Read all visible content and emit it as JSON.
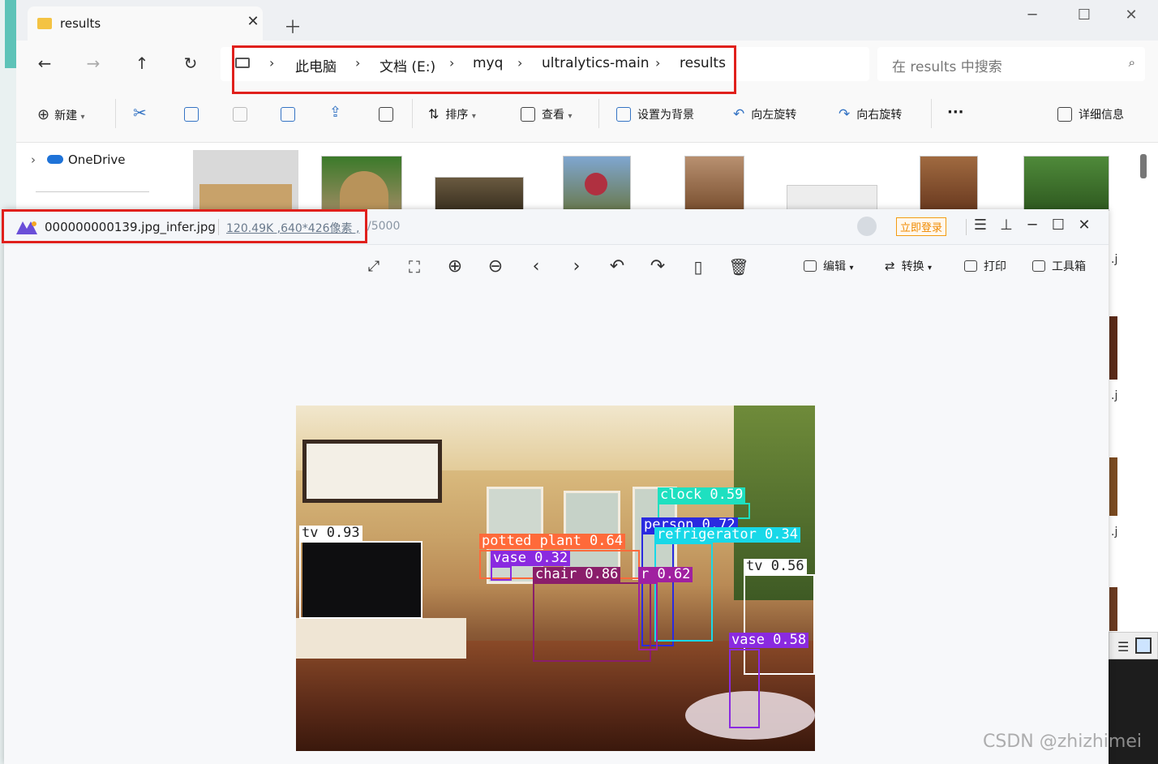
{
  "explorer": {
    "tab_title": "results",
    "address": {
      "crumbs": [
        "此电脑",
        "文档 (E:)",
        "myq",
        "ultralytics-main",
        "results"
      ]
    },
    "search_placeholder": "在 results 中搜索",
    "toolbar": {
      "new": "新建",
      "sort": "排序",
      "view": "查看",
      "set_background": "设置为背景",
      "rotate_left": "向左旋转",
      "rotate_right": "向右旋转",
      "more": "···",
      "details": "详细信息"
    },
    "sidebar": {
      "onedrive": "OneDrive"
    }
  },
  "viewer": {
    "filename": "000000000139.jpg_infer.jpg",
    "meta": "120.49K ,640*426像素 ,",
    "page": "/5000",
    "login": "立即登录",
    "tools": {
      "edit": "编辑",
      "convert": "转换",
      "print": "打印",
      "toolbox": "工具箱"
    },
    "detections": [
      {
        "label": "clock 0.59"
      },
      {
        "label": "person 0.72"
      },
      {
        "label": "refrigerator 0.34"
      },
      {
        "label": "tv 0.93"
      },
      {
        "label": "potted plant 0.64"
      },
      {
        "label": "vase 0.32"
      },
      {
        "label": "chair 0.86"
      },
      {
        "label": "r 0.62"
      },
      {
        "label": "tv 0.56"
      },
      {
        "label": "vase 0.58"
      }
    ]
  },
  "watermark": "CSDN @zhizhimei",
  "right_edge_text": [
    ".j",
    ".j",
    ".j"
  ],
  "colors": {
    "red_highlight": "#e0201c",
    "login_orange": "#f08a00",
    "accent_blue": "#3574c4"
  }
}
